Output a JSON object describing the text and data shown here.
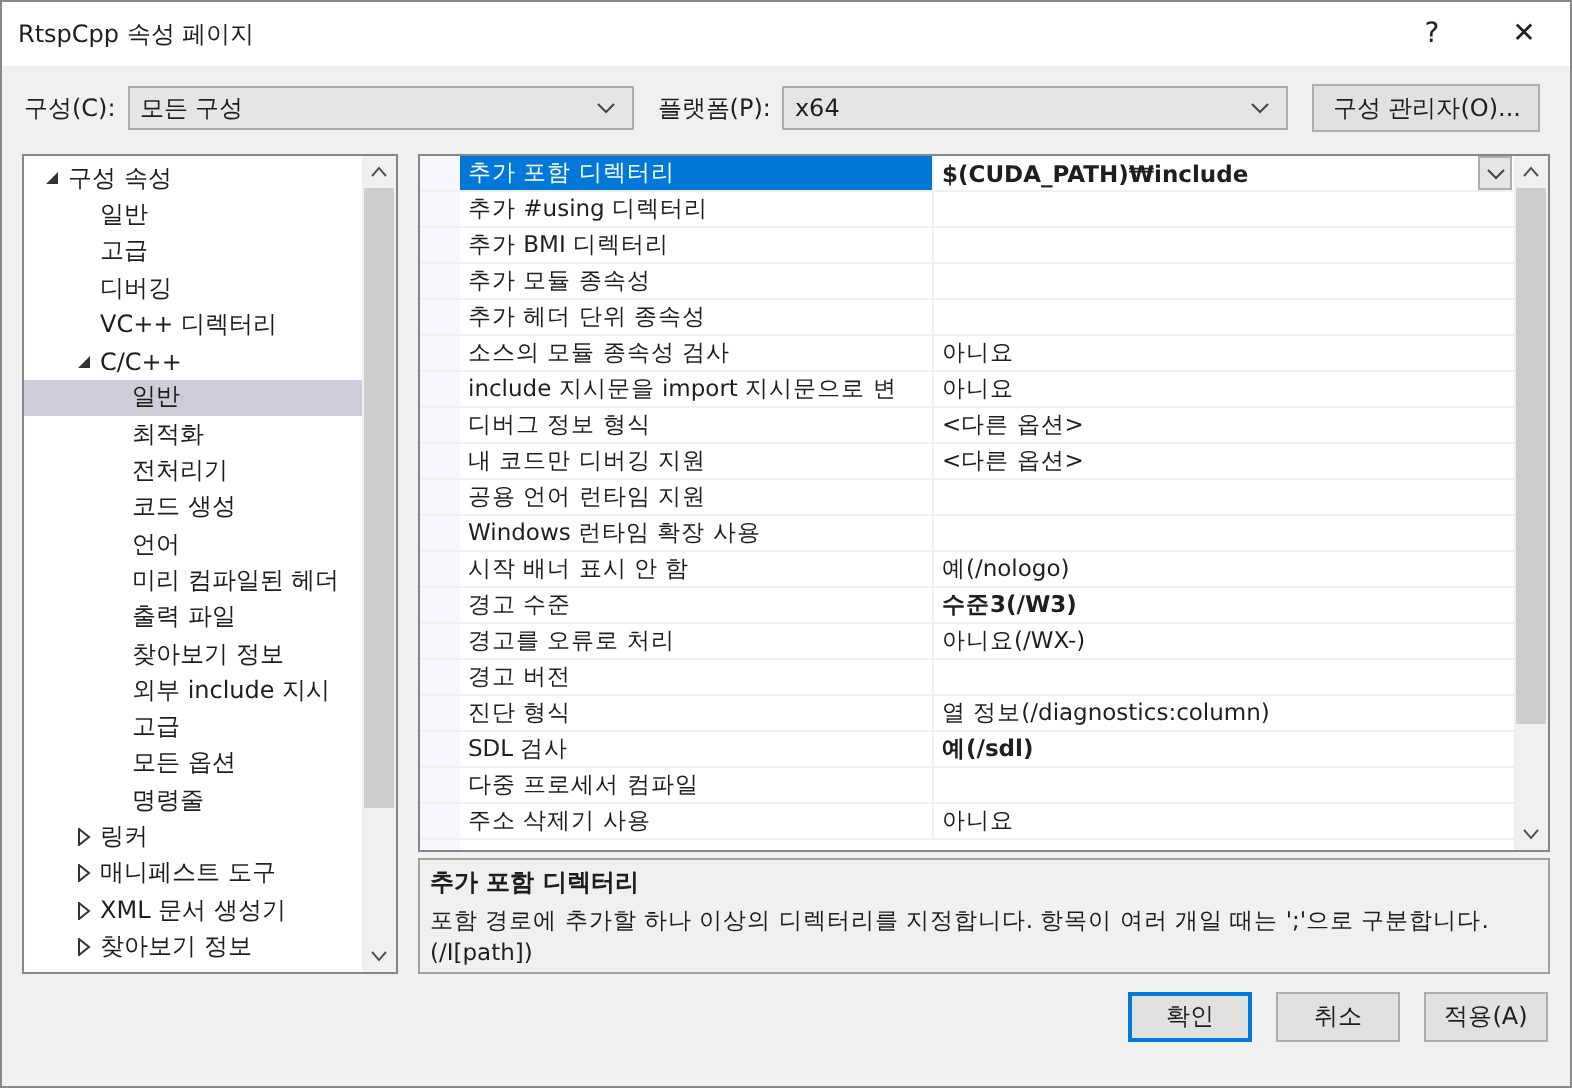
{
  "window": {
    "title": "RtspCpp 속성 페이지",
    "help": "?",
    "close": "✕"
  },
  "toolbar": {
    "config_label": "구성(C):",
    "config_value": "모든 구성",
    "platform_label": "플랫폼(P):",
    "platform_value": "x64",
    "manager_button": "구성 관리자(O)..."
  },
  "tree": [
    {
      "label": "구성 속성",
      "expanded": true,
      "selected": false,
      "children": [
        {
          "label": "일반",
          "selected": false
        },
        {
          "label": "고급",
          "selected": false
        },
        {
          "label": "디버깅",
          "selected": false
        },
        {
          "label": "VC++ 디렉터리",
          "selected": false
        },
        {
          "label": "C/C++",
          "expanded": true,
          "selected": false,
          "children": [
            {
              "label": "일반",
              "selected": true
            },
            {
              "label": "최적화",
              "selected": false
            },
            {
              "label": "전처리기",
              "selected": false
            },
            {
              "label": "코드 생성",
              "selected": false
            },
            {
              "label": "언어",
              "selected": false
            },
            {
              "label": "미리 컴파일된 헤더",
              "selected": false
            },
            {
              "label": "출력 파일",
              "selected": false
            },
            {
              "label": "찾아보기 정보",
              "selected": false
            },
            {
              "label": "외부 include 지시",
              "selected": false
            },
            {
              "label": "고급",
              "selected": false
            },
            {
              "label": "모든 옵션",
              "selected": false
            },
            {
              "label": "명령줄",
              "selected": false
            }
          ]
        },
        {
          "label": "링커",
          "expanded": false,
          "selected": false
        },
        {
          "label": "매니페스트 도구",
          "expanded": false,
          "selected": false
        },
        {
          "label": "XML 문서 생성기",
          "expanded": false,
          "selected": false
        },
        {
          "label": "찾아보기 정보",
          "expanded": false,
          "selected": false
        }
      ]
    }
  ],
  "properties": [
    {
      "name": "추가 포함 디렉터리",
      "value": "$(CUDA_PATH)₩include",
      "bold": true,
      "selected": true
    },
    {
      "name": "추가 #using 디렉터리",
      "selected": false
    },
    {
      "name": "추가 BMI 디렉터리",
      "selected": false
    },
    {
      "name": "추가 모듈 종속성",
      "selected": false
    },
    {
      "name": "추가 헤더 단위 종속성",
      "selected": false
    },
    {
      "name": "소스의 모듈 종속성 검사",
      "value": "아니요",
      "bold": false,
      "selected": false
    },
    {
      "name": "include 지시문을 import 지시문으로 변",
      "value": "아니요",
      "bold": false,
      "selected": false
    },
    {
      "name": "디버그 정보 형식",
      "value": "<다른 옵션>",
      "bold": false,
      "selected": false
    },
    {
      "name": "내 코드만 디버깅 지원",
      "value": "<다른 옵션>",
      "bold": false,
      "selected": false
    },
    {
      "name": "공용 언어 런타임 지원",
      "selected": false
    },
    {
      "name": "Windows 런타임 확장 사용",
      "selected": false
    },
    {
      "name": "시작 배너 표시 안 함",
      "value": "예(/nologo)",
      "bold": false,
      "selected": false
    },
    {
      "name": "경고 수준",
      "value": "수준3(/W3)",
      "bold": true,
      "selected": false
    },
    {
      "name": "경고를 오류로 처리",
      "value": "아니요(/WX-)",
      "bold": false,
      "selected": false
    },
    {
      "name": "경고 버전",
      "selected": false
    },
    {
      "name": "진단 형식",
      "value": "열 정보(/diagnostics:column)",
      "bold": false,
      "selected": false
    },
    {
      "name": "SDL 검사",
      "value": "예(/sdl)",
      "bold": true,
      "selected": false
    },
    {
      "name": "다중 프로세서 컴파일",
      "selected": false
    },
    {
      "name": "주소 삭제기 사용",
      "value": "아니요",
      "bold": false,
      "selected": false
    }
  ],
  "description": {
    "title": "추가 포함 디렉터리",
    "text": "포함 경로에 추가할 하나 이상의 디렉터리를 지정합니다. 항목이 여러 개일 때는 ';'으로 구분합니다. (/I[path])"
  },
  "buttons": [
    {
      "label": "확인",
      "default": true
    },
    {
      "label": "취소",
      "default": false
    },
    {
      "label": "적용(A)",
      "default": false
    }
  ]
}
